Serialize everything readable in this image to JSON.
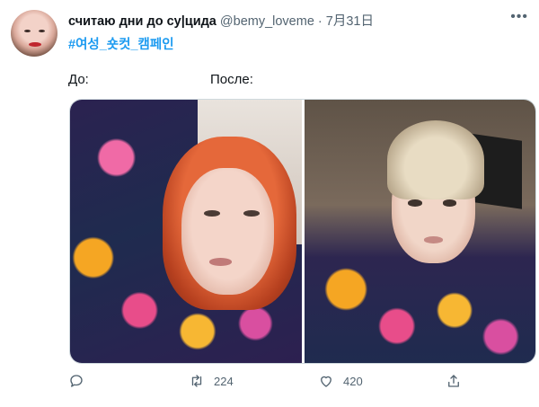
{
  "tweet": {
    "author_name": "считаю дни до су|цида",
    "author_handle": "@bemy_loveme",
    "separator": "·",
    "date": "7月31日",
    "hashtag": "#여성_숏컷_캠페인",
    "before_label": "До:",
    "after_label": "После:"
  },
  "actions": {
    "reply_count": "",
    "retweet_count": "224",
    "like_count": "420"
  },
  "icons": {
    "more": "more-icon",
    "reply": "reply-icon",
    "retweet": "retweet-icon",
    "like": "heart-icon",
    "share": "share-icon"
  },
  "colors": {
    "link": "#1d9bf0",
    "secondary_text": "#536471",
    "primary_text": "#0f1419"
  }
}
